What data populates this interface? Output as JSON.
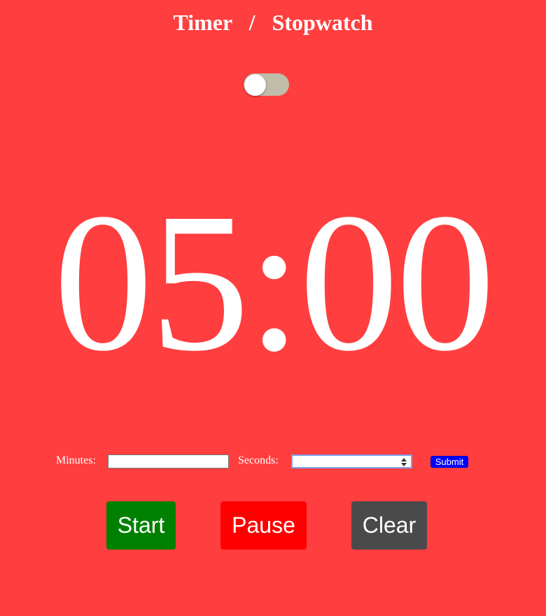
{
  "header": {
    "timer_label": "Timer",
    "separator": "/",
    "stopwatch_label": "Stopwatch"
  },
  "mode_toggle": {
    "state": "off",
    "track_color": "#c0bda8"
  },
  "display": {
    "time": "05:00"
  },
  "form": {
    "minutes_label": "Minutes:",
    "minutes_value": "",
    "seconds_label": "Seconds:",
    "seconds_value": "",
    "submit_label": "Submit"
  },
  "controls": {
    "start_label": "Start",
    "pause_label": "Pause",
    "clear_label": "Clear"
  },
  "colors": {
    "background": "#ff3e3f",
    "start": "#008000",
    "pause": "#ff0000",
    "clear": "#4a4a4a",
    "submit": "#0000ff"
  }
}
